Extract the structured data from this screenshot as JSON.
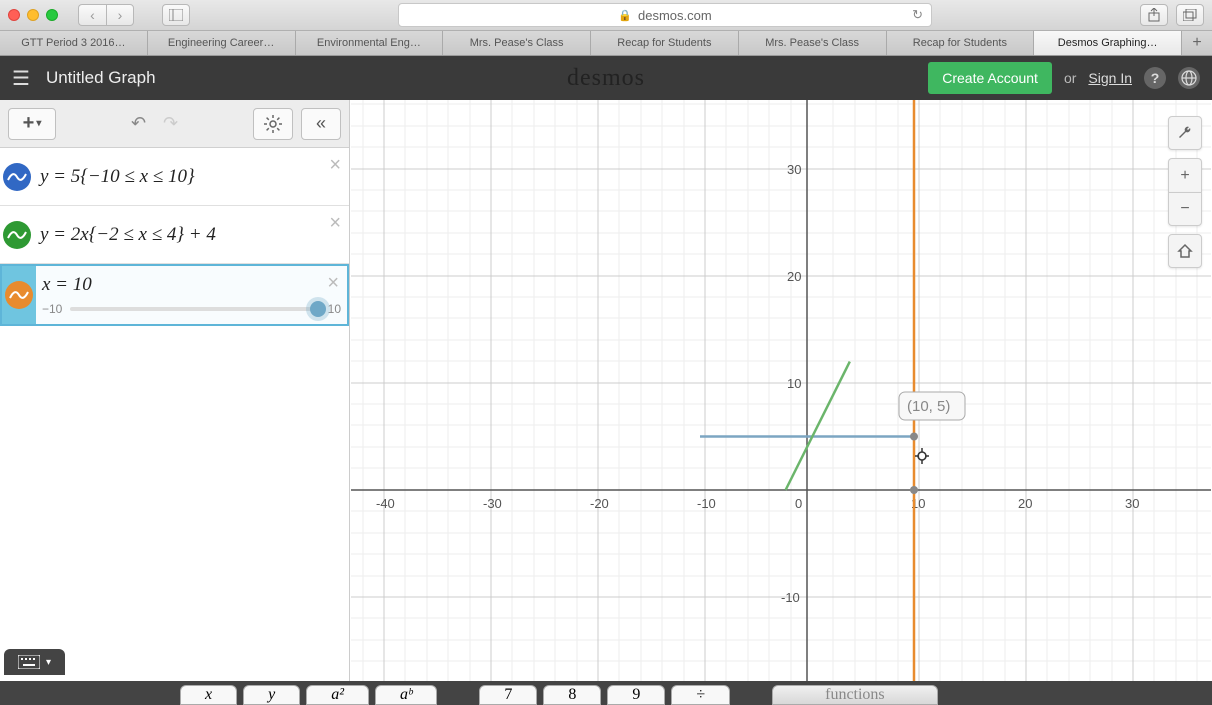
{
  "browser": {
    "url_host": "desmos.com",
    "tabs": [
      "GTT Period 3 2016…",
      "Engineering Career…",
      "Environmental Eng…",
      "Mrs. Pease's Class",
      "Recap for Students",
      "Mrs. Pease's Class",
      "Recap for Students",
      "Desmos Graphing…"
    ],
    "active_tab_index": 7
  },
  "header": {
    "title": "Untitled Graph",
    "logo": "desmos",
    "create_account": "Create Account",
    "or": "or",
    "sign_in": "Sign In",
    "help": "?",
    "language": "🌐"
  },
  "expressions": [
    {
      "icon_color": "#3168c4",
      "formula": "y = 5{−10 ≤ x ≤ 10}"
    },
    {
      "icon_color": "#2e9933",
      "formula": "y = 2x{−2 ≤ x ≤ 4} + 4"
    },
    {
      "icon_color": "#e88b2e",
      "formula": "x = 10",
      "selected": true,
      "slider": {
        "min": "−10",
        "max": "10",
        "value": 10
      }
    }
  ],
  "graph": {
    "x_ticks": [
      "-40",
      "-30",
      "-20",
      "-10",
      "0",
      "10",
      "20",
      "30"
    ],
    "y_ticks": [
      "-10",
      "10",
      "20",
      "30"
    ],
    "point_label": "(10, 5)"
  },
  "keypad": {
    "keys": [
      "x",
      "y",
      "a²",
      "aᵇ",
      "7",
      "8",
      "9",
      "÷"
    ],
    "functions_label": "functions"
  },
  "chart_data": {
    "type": "line",
    "title": "",
    "xlabel": "",
    "ylabel": "",
    "xlim": [
      -45,
      35
    ],
    "ylim": [
      -18,
      38
    ],
    "series": [
      {
        "name": "y = 5 on [-10,10]",
        "color": "#7ca5c2",
        "x": [
          -10,
          10
        ],
        "y": [
          5,
          5
        ]
      },
      {
        "name": "y = 2x + 4 on [-2,4]",
        "color": "#6bb56b",
        "x": [
          -2,
          4
        ],
        "y": [
          0,
          12
        ]
      },
      {
        "name": "x = 10 (vertical)",
        "color": "#e88b2e",
        "x": [
          10,
          10
        ],
        "y": [
          -18,
          38
        ]
      }
    ],
    "points": [
      {
        "x": 10,
        "y": 5,
        "label": "(10, 5)"
      }
    ]
  }
}
